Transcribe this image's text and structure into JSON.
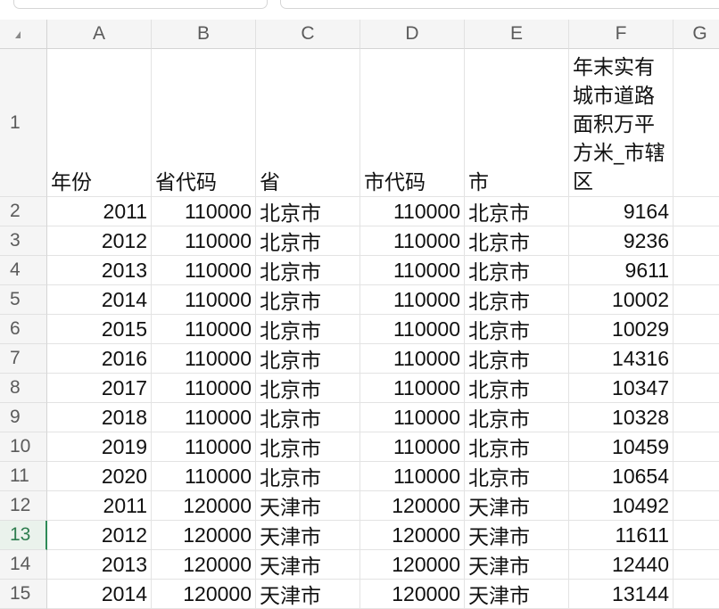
{
  "columns": [
    "A",
    "B",
    "C",
    "D",
    "E",
    "F",
    "G"
  ],
  "header_row": {
    "row_num": "1",
    "cells": [
      "年份",
      "省代码",
      "省",
      "市代码",
      "市",
      "年末实有城市道路面积万平方米_市辖区"
    ]
  },
  "rows": [
    {
      "row_num": "2",
      "year": "2011",
      "prov_code": "110000",
      "prov": "北京市",
      "city_code": "110000",
      "city": "北京市",
      "area": "9164"
    },
    {
      "row_num": "3",
      "year": "2012",
      "prov_code": "110000",
      "prov": "北京市",
      "city_code": "110000",
      "city": "北京市",
      "area": "9236"
    },
    {
      "row_num": "4",
      "year": "2013",
      "prov_code": "110000",
      "prov": "北京市",
      "city_code": "110000",
      "city": "北京市",
      "area": "9611"
    },
    {
      "row_num": "5",
      "year": "2014",
      "prov_code": "110000",
      "prov": "北京市",
      "city_code": "110000",
      "city": "北京市",
      "area": "10002"
    },
    {
      "row_num": "6",
      "year": "2015",
      "prov_code": "110000",
      "prov": "北京市",
      "city_code": "110000",
      "city": "北京市",
      "area": "10029"
    },
    {
      "row_num": "7",
      "year": "2016",
      "prov_code": "110000",
      "prov": "北京市",
      "city_code": "110000",
      "city": "北京市",
      "area": "14316"
    },
    {
      "row_num": "8",
      "year": "2017",
      "prov_code": "110000",
      "prov": "北京市",
      "city_code": "110000",
      "city": "北京市",
      "area": "10347"
    },
    {
      "row_num": "9",
      "year": "2018",
      "prov_code": "110000",
      "prov": "北京市",
      "city_code": "110000",
      "city": "北京市",
      "area": "10328"
    },
    {
      "row_num": "10",
      "year": "2019",
      "prov_code": "110000",
      "prov": "北京市",
      "city_code": "110000",
      "city": "北京市",
      "area": "10459"
    },
    {
      "row_num": "11",
      "year": "2020",
      "prov_code": "110000",
      "prov": "北京市",
      "city_code": "110000",
      "city": "北京市",
      "area": "10654"
    },
    {
      "row_num": "12",
      "year": "2011",
      "prov_code": "120000",
      "prov": "天津市",
      "city_code": "120000",
      "city": "天津市",
      "area": "10492"
    },
    {
      "row_num": "13",
      "year": "2012",
      "prov_code": "120000",
      "prov": "天津市",
      "city_code": "120000",
      "city": "天津市",
      "area": "11611"
    },
    {
      "row_num": "14",
      "year": "2013",
      "prov_code": "120000",
      "prov": "天津市",
      "city_code": "120000",
      "city": "天津市",
      "area": "12440"
    },
    {
      "row_num": "15",
      "year": "2014",
      "prov_code": "120000",
      "prov": "天津市",
      "city_code": "120000",
      "city": "天津市",
      "area": "13144"
    }
  ],
  "active_row": "13",
  "colors": {
    "active_row_accent": "#2e8b57",
    "header_bg": "#f5f5f5"
  }
}
